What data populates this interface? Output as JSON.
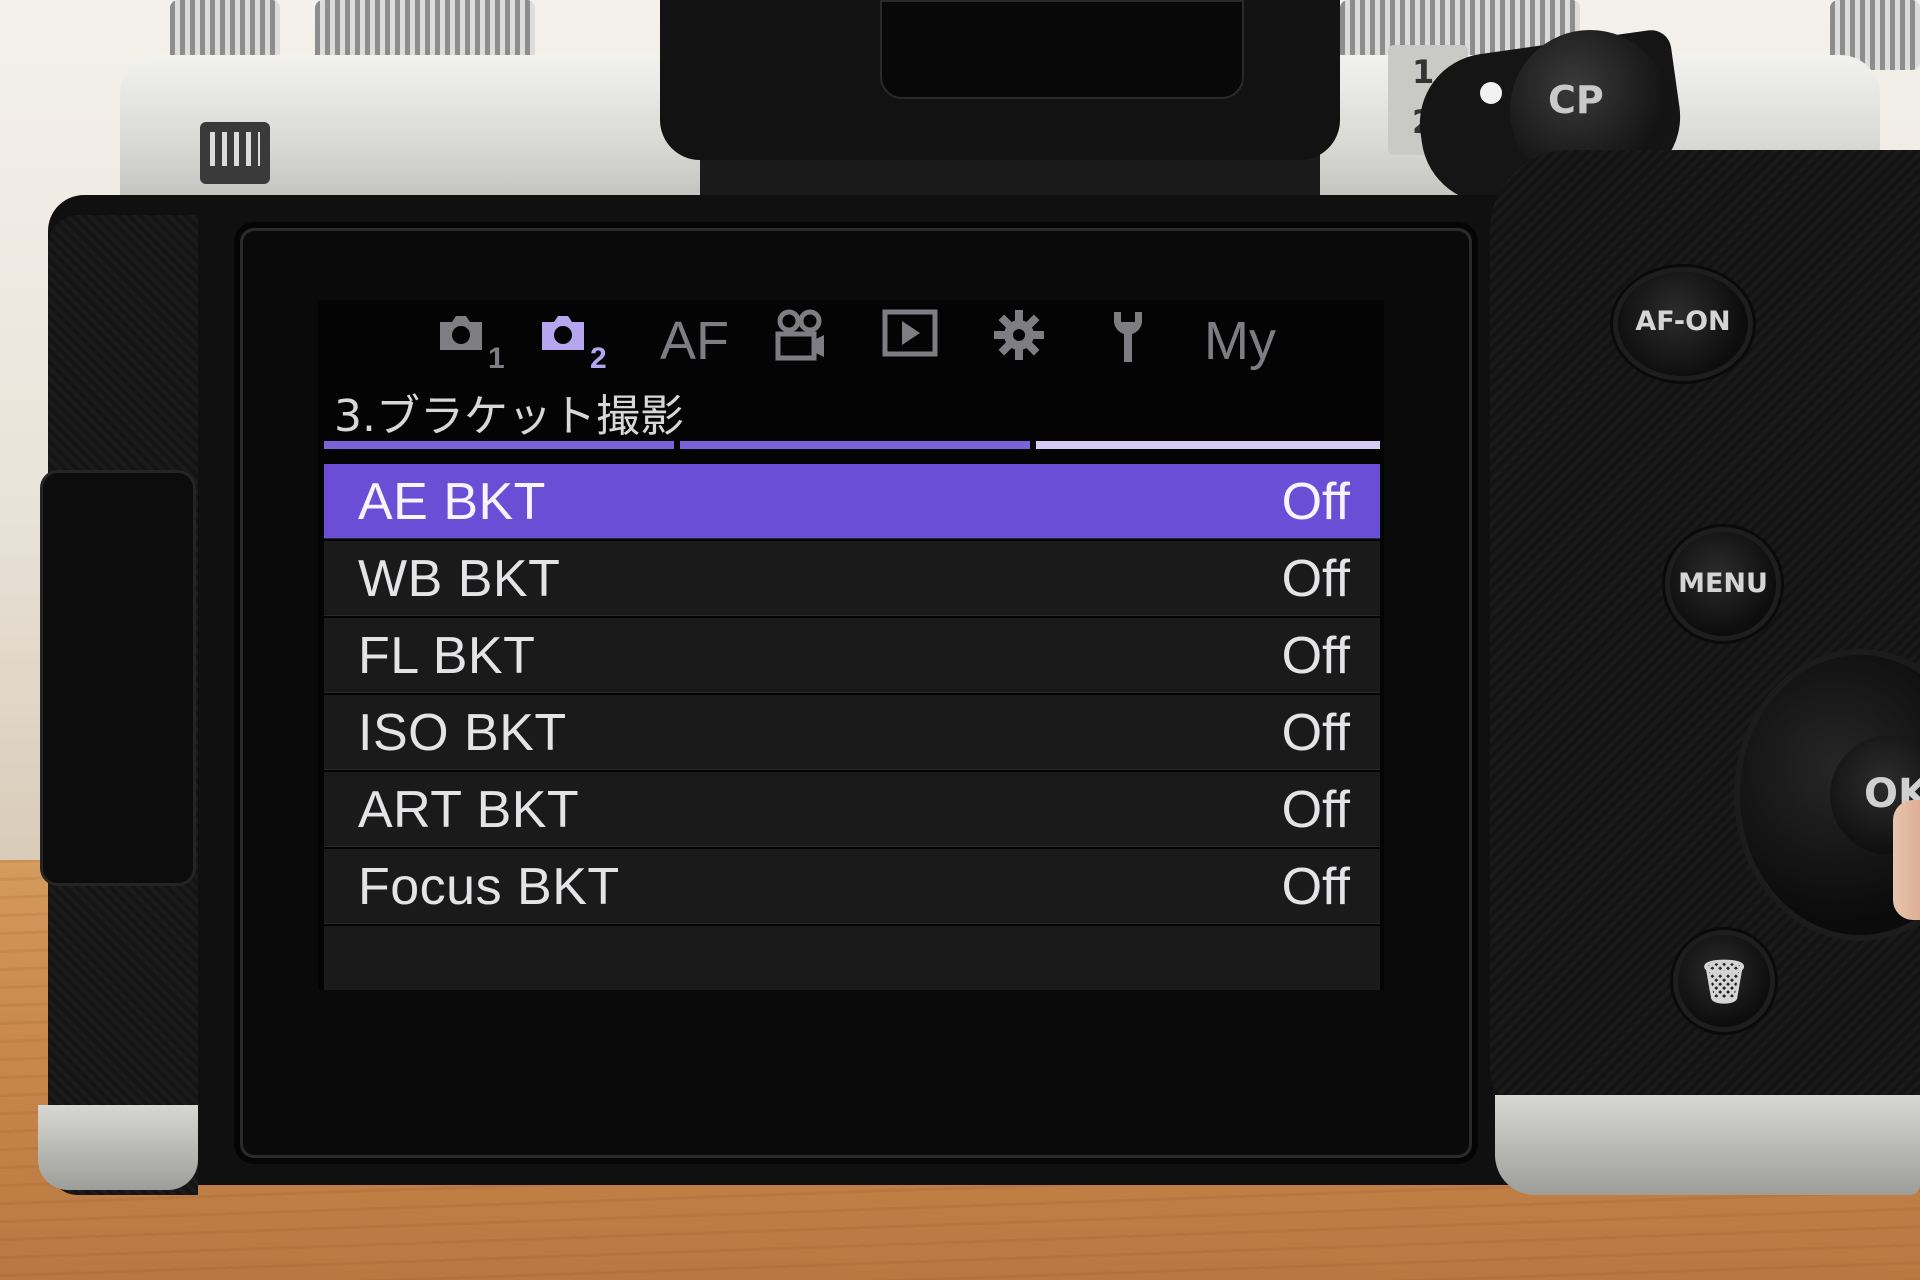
{
  "camera": {
    "cp_button": "CP",
    "dial_marks": [
      "1",
      "2"
    ],
    "af_on_button": "AF-ON",
    "menu_button": "MENU",
    "ok_button": "OK",
    "trash_button": "🗑"
  },
  "menu": {
    "tabs": [
      {
        "id": "shooting1",
        "icon": "camera-icon",
        "sub": "1",
        "active": false
      },
      {
        "id": "shooting2",
        "icon": "camera-icon",
        "sub": "2",
        "active": true
      },
      {
        "id": "af",
        "label": "AF",
        "active": false
      },
      {
        "id": "video",
        "icon": "video-icon",
        "active": false
      },
      {
        "id": "playback",
        "icon": "play-icon",
        "active": false
      },
      {
        "id": "custom",
        "icon": "gear-icon",
        "active": false
      },
      {
        "id": "setup",
        "icon": "wrench-icon",
        "active": false
      },
      {
        "id": "my",
        "label": "My",
        "active": false
      }
    ],
    "section_title": "3.ブラケット撮影",
    "page_indicator": {
      "pages": 3,
      "current": 3
    },
    "items": [
      {
        "label": "AE BKT",
        "value": "Off",
        "selected": true
      },
      {
        "label": "WB BKT",
        "value": "Off",
        "selected": false
      },
      {
        "label": "FL BKT",
        "value": "Off",
        "selected": false
      },
      {
        "label": "ISO BKT",
        "value": "Off",
        "selected": false
      },
      {
        "label": "ART BKT",
        "value": "Off",
        "selected": false
      },
      {
        "label": "Focus BKT",
        "value": "Off",
        "selected": false
      }
    ]
  },
  "colors": {
    "accent": "#6a4fd6",
    "tab_active": "#b5a6ef",
    "tab_inactive": "#7d7d82",
    "page_bar": "#7a63d6",
    "page_bar_current": "#d4ccf2"
  }
}
